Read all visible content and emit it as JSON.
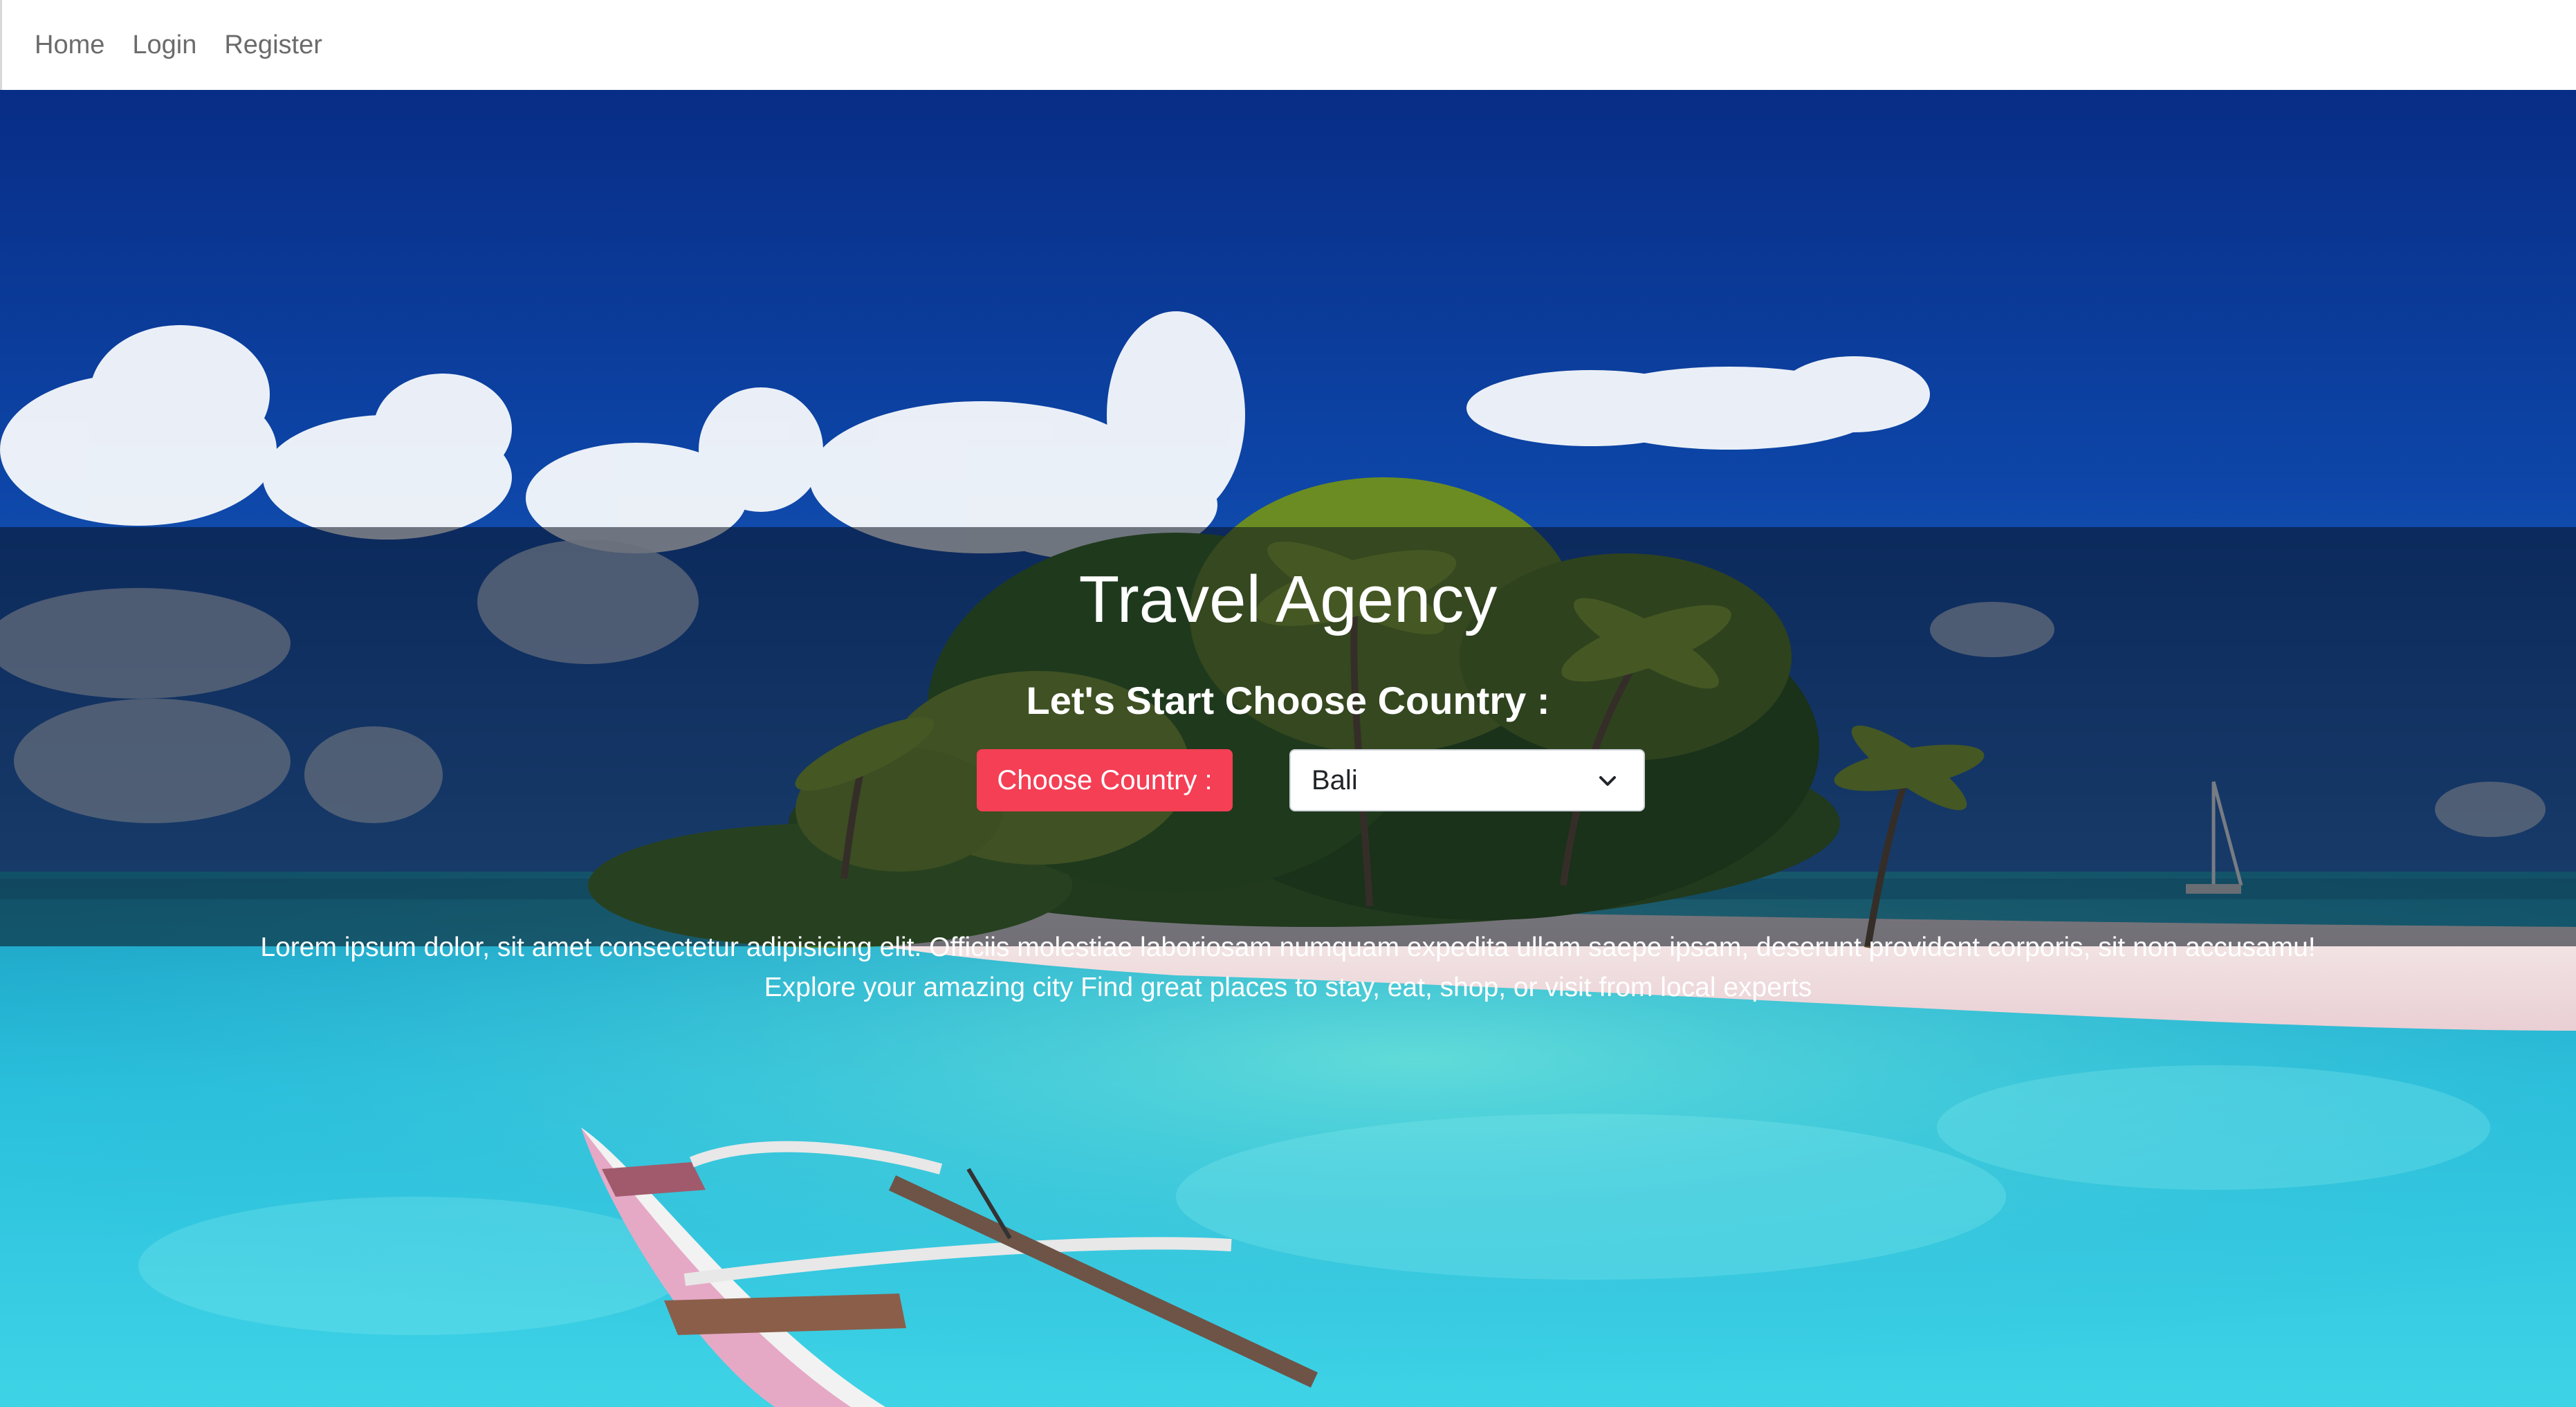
{
  "nav": {
    "items": [
      {
        "label": "Home"
      },
      {
        "label": "Login"
      },
      {
        "label": "Register"
      }
    ]
  },
  "hero": {
    "title": "Travel Agency",
    "subtitle": "Let's Start Choose Country :",
    "choose_button_label": "Choose Country :",
    "country_select": {
      "selected": "Bali",
      "icon": "chevron-down-icon"
    },
    "description_line_1": "Lorem ipsum dolor, sit amet consectetur adipisicing elit. Officiis molestiae laboriosam numquam expedita ullam saepe ipsam, deserunt provident corporis, sit non accusamu!",
    "description_line_2": "Explore your amazing city Find great places to stay, eat, shop, or visit from local experts"
  },
  "colors": {
    "accent": "#f43f55",
    "sky": "#0b3a93",
    "water": "#1fb6d6",
    "overlay": "rgba(10,16,30,0.55)"
  }
}
